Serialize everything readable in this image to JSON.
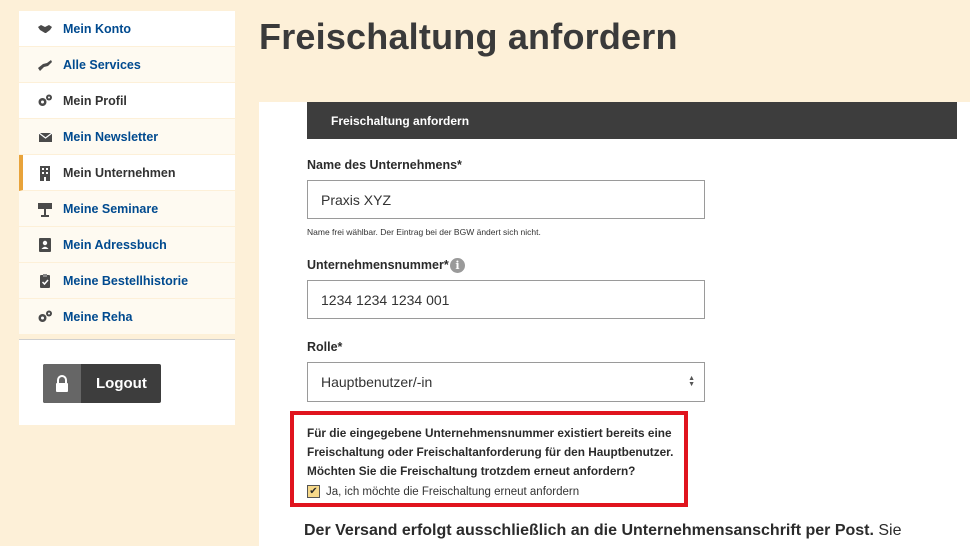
{
  "sidebar": {
    "items": [
      {
        "label": "Mein Konto",
        "icon": "handshake-icon"
      },
      {
        "label": "Alle Services",
        "icon": "hand-icon"
      },
      {
        "label": "Mein Profil",
        "icon": "gears-icon"
      },
      {
        "label": "Mein Newsletter",
        "icon": "envelope-icon"
      },
      {
        "label": "Mein Unternehmen",
        "icon": "building-icon"
      },
      {
        "label": "Meine Seminare",
        "icon": "lectern-icon"
      },
      {
        "label": "Mein Adressbuch",
        "icon": "address-book-icon"
      },
      {
        "label": "Meine Bestellhistorie",
        "icon": "clipboard-check-icon"
      },
      {
        "label": "Meine Reha",
        "icon": "gears-icon"
      }
    ],
    "logout_label": "Logout"
  },
  "page": {
    "title": "Freischaltung anfordern"
  },
  "form": {
    "header": "Freischaltung anfordern",
    "company_name_label": "Name des Unternehmens*",
    "company_name_value": "Praxis XYZ",
    "company_name_hint": "Name frei wählbar. Der Eintrag bei der BGW ändert sich nicht.",
    "company_number_label": "Unternehmensnummer*",
    "company_number_value": "1234 1234 1234 001",
    "info_glyph": "i",
    "role_label": "Rolle*",
    "role_value": "Hauptbenutzer/-in",
    "warning_text": "Für die eingegebene Unternehmensnummer existiert bereits eine Freischaltung oder Freischaltanforderung für den Hauptbenutzer. Möchten Sie die Freischaltung trotzdem erneut anfordern?",
    "confirm_label": "Ja, ich möchte die Freischaltung erneut anfordern",
    "confirm_checked": true,
    "versand_bold": "Der Versand erfolgt ausschließlich an die Unternehmensanschrift per Post.",
    "versand_rest": " Sie"
  },
  "colors": {
    "background": "#fdf0d8",
    "nav_link": "#004a8f",
    "dark": "#3d3d3d",
    "warning_border": "#e0141e",
    "active_accent": "#e8a33b"
  }
}
